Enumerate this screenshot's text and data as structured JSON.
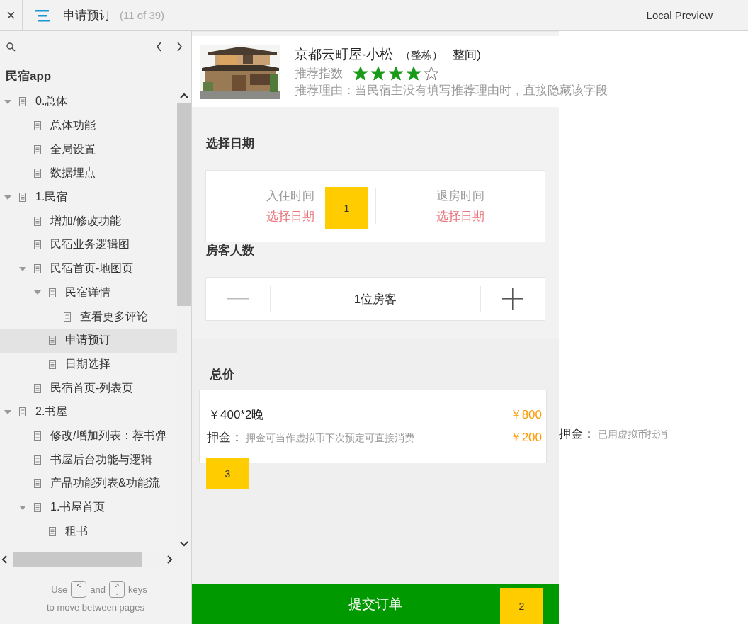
{
  "topbar": {
    "close": "×",
    "title": "申请预订",
    "page_count": "(11 of 39)",
    "preview": "Local Preview"
  },
  "sidebar": {
    "project": "民宿app",
    "tree": [
      {
        "label": "0.总体",
        "expanded": true,
        "selected": false,
        "children": [
          {
            "label": "总体功能",
            "selected": false
          },
          {
            "label": "全局设置",
            "selected": false
          },
          {
            "label": "数据埋点",
            "selected": false
          }
        ]
      },
      {
        "label": "1.民宿",
        "expanded": true,
        "selected": false,
        "children": [
          {
            "label": "增加/修改功能",
            "selected": false
          },
          {
            "label": "民宿业务逻辑图",
            "selected": false
          },
          {
            "label": "民宿首页-地图页",
            "expanded": true,
            "selected": false,
            "children": [
              {
                "label": "民宿详情",
                "expanded": true,
                "selected": false,
                "children": [
                  {
                    "label": "查看更多评论",
                    "selected": false
                  }
                ]
              },
              {
                "label": "申请预订",
                "selected": true
              },
              {
                "label": "日期选择",
                "selected": false
              }
            ]
          },
          {
            "label": "民宿首页-列表页",
            "selected": false
          }
        ]
      },
      {
        "label": "2.书屋",
        "expanded": true,
        "selected": false,
        "children": [
          {
            "label": "修改/增加列表：荐书弹",
            "selected": false
          },
          {
            "label": "书屋后台功能与逻辑",
            "selected": false
          },
          {
            "label": "产品功能列表&功能流",
            "selected": false
          },
          {
            "label": "1.书屋首页",
            "expanded": true,
            "selected": false,
            "children": [
              {
                "label": "租书",
                "selected": false
              }
            ]
          }
        ]
      }
    ],
    "hint": {
      "before": "Use",
      "key_prev": {
        "top": "<",
        "bottom": ";"
      },
      "middle": "and",
      "key_next": {
        "top": ">",
        "bottom": "."
      },
      "after": "keys",
      "line2": "to move between pages"
    }
  },
  "listing": {
    "title": "京都云町屋-小松",
    "tag": "（整栋）",
    "tag2": "整间)",
    "rating_label": "推荐指数",
    "stars": 4,
    "reason": "推荐理由：当民宿主没有填写推荐理由时，直接隐藏该字段"
  },
  "dates": {
    "label": "选择日期",
    "checkin": {
      "label": "入住时间",
      "value": "选择日期"
    },
    "checkout": {
      "label": "退房时间",
      "value": "选择日期"
    },
    "badge": "1"
  },
  "guests": {
    "label": "房客人数",
    "value": "1位房客"
  },
  "total": {
    "label": "总价",
    "rows": [
      {
        "label": "￥400*2晚",
        "amount": "￥800"
      },
      {
        "label": "押金：",
        "note": "押金可当作虚拟币下次预定可直接消费",
        "amount": "￥200"
      }
    ],
    "aside": {
      "label": "押金：",
      "note": "已用虚拟币抵消"
    },
    "badge": "3"
  },
  "submit": {
    "label": "提交订单",
    "badge": "2"
  }
}
